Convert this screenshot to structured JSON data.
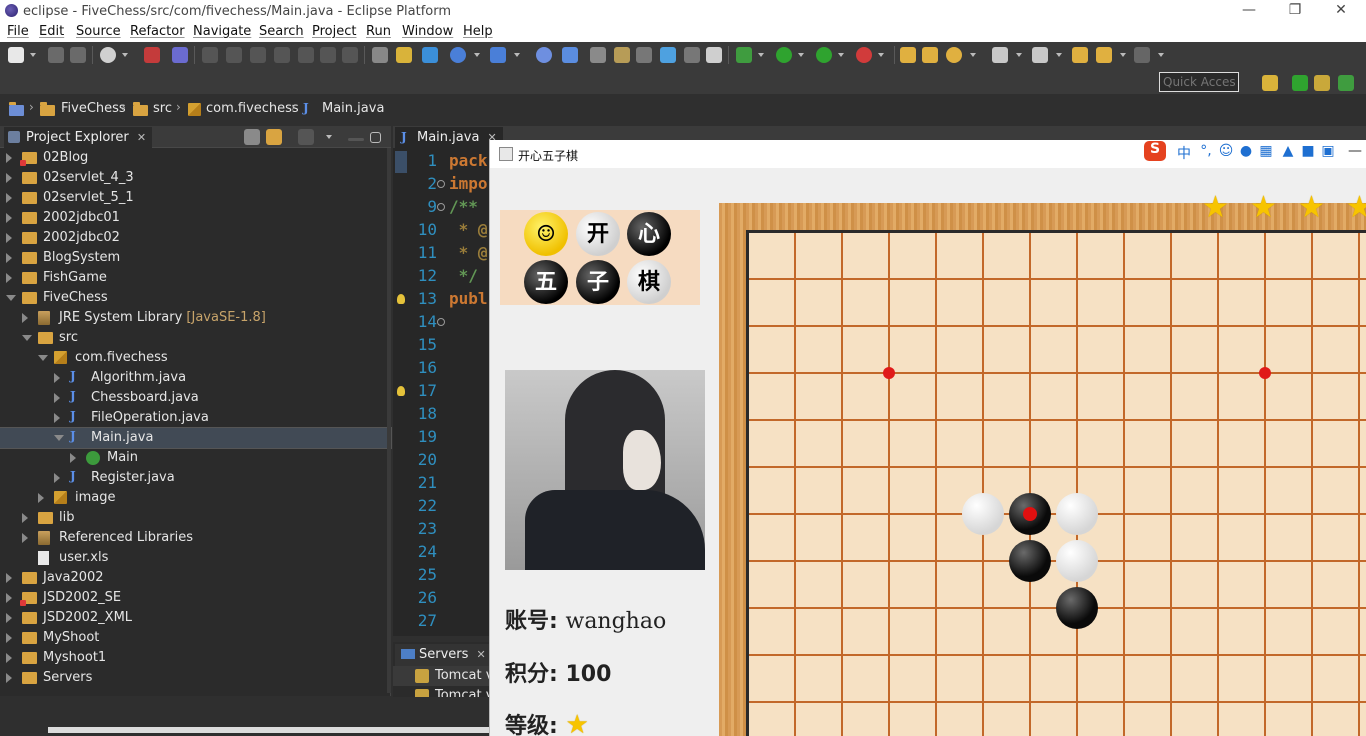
{
  "window": {
    "title": "eclipse - FiveChess/src/com/fivechess/Main.java - Eclipse Platform",
    "minimize": "—",
    "restore": "❐",
    "close": "✕"
  },
  "menu": [
    "File",
    "Edit",
    "Source",
    "Refactor",
    "Navigate",
    "Search",
    "Project",
    "Run",
    "Window",
    "Help"
  ],
  "toolbar": {
    "quick_access_placeholder": "Quick Access"
  },
  "breadcrumb": [
    "FiveChess",
    "src",
    "com.fivechess",
    "Main.java"
  ],
  "explorer": {
    "tab_label": "Project Explorer",
    "tab_close": "✕",
    "items": [
      {
        "label": "02Blog",
        "depth": 0,
        "kind": "project-error",
        "open": false
      },
      {
        "label": "02servlet_4_3",
        "depth": 0,
        "kind": "project",
        "open": false
      },
      {
        "label": "02servlet_5_1",
        "depth": 0,
        "kind": "project",
        "open": false
      },
      {
        "label": "2002jdbc01",
        "depth": 0,
        "kind": "project",
        "open": false
      },
      {
        "label": "2002jdbc02",
        "depth": 0,
        "kind": "project",
        "open": false
      },
      {
        "label": "BlogSystem",
        "depth": 0,
        "kind": "project",
        "open": false
      },
      {
        "label": "FishGame",
        "depth": 0,
        "kind": "project",
        "open": false
      },
      {
        "label": "FiveChess",
        "depth": 0,
        "kind": "project",
        "open": true
      },
      {
        "label": "JRE System Library",
        "suffix": "[JavaSE-1.8]",
        "depth": 1,
        "kind": "library",
        "open": false
      },
      {
        "label": "src",
        "depth": 1,
        "kind": "folder",
        "open": true
      },
      {
        "label": "com.fivechess",
        "depth": 2,
        "kind": "package",
        "open": true
      },
      {
        "label": "Algorithm.java",
        "depth": 3,
        "kind": "java",
        "open": false
      },
      {
        "label": "Chessboard.java",
        "depth": 3,
        "kind": "java",
        "open": false
      },
      {
        "label": "FileOperation.java",
        "depth": 3,
        "kind": "java",
        "open": false
      },
      {
        "label": "Main.java",
        "depth": 3,
        "kind": "java",
        "open": true,
        "selected": true
      },
      {
        "label": "Main",
        "depth": 4,
        "kind": "class",
        "open": false
      },
      {
        "label": "Register.java",
        "depth": 3,
        "kind": "java",
        "open": false
      },
      {
        "label": "image",
        "depth": 2,
        "kind": "package",
        "open": false
      },
      {
        "label": "lib",
        "depth": 1,
        "kind": "folder",
        "open": false
      },
      {
        "label": "Referenced Libraries",
        "depth": 1,
        "kind": "library",
        "open": false
      },
      {
        "label": "user.xls",
        "depth": 1,
        "kind": "file",
        "open": false,
        "noarrow": true
      },
      {
        "label": "Java2002",
        "depth": 0,
        "kind": "project",
        "open": false
      },
      {
        "label": "JSD2002_SE",
        "depth": 0,
        "kind": "project-error",
        "open": false
      },
      {
        "label": "JSD2002_XML",
        "depth": 0,
        "kind": "project",
        "open": false
      },
      {
        "label": "MyShoot",
        "depth": 0,
        "kind": "project",
        "open": false
      },
      {
        "label": "Myshoot1",
        "depth": 0,
        "kind": "project",
        "open": false
      },
      {
        "label": "Servers",
        "depth": 0,
        "kind": "project",
        "open": false
      }
    ]
  },
  "editor": {
    "tab_label": "Main.java",
    "tab_close": "✕",
    "lines": [
      {
        "n": "1",
        "code": "pack",
        "color": "#cc7832"
      },
      {
        "n": "2",
        "code": "impo",
        "color": "#cc7832",
        "fold": true
      },
      {
        "n": "9",
        "code": "/**",
        "color": "#629755",
        "fold": true
      },
      {
        "n": "10",
        "code": " * @",
        "color": "#9a7d3a"
      },
      {
        "n": "11",
        "code": " * @",
        "color": "#9a7d3a"
      },
      {
        "n": "12",
        "code": " */",
        "color": "#629755"
      },
      {
        "n": "13",
        "code": "publ",
        "color": "#cc7832",
        "bulb": true
      },
      {
        "n": "14",
        "code": "",
        "color": "#ddd",
        "fold": true
      },
      {
        "n": "15",
        "code": "",
        "color": "#ddd"
      },
      {
        "n": "16",
        "code": "",
        "color": "#ddd"
      },
      {
        "n": "17",
        "code": "",
        "color": "#ddd",
        "bulb": true
      },
      {
        "n": "18",
        "code": "",
        "color": "#ddd"
      },
      {
        "n": "19",
        "code": "",
        "color": "#ddd"
      },
      {
        "n": "20",
        "code": "",
        "color": "#ddd"
      },
      {
        "n": "21",
        "code": "",
        "color": "#ddd"
      },
      {
        "n": "22",
        "code": "",
        "color": "#ddd"
      },
      {
        "n": "23",
        "code": "",
        "color": "#ddd"
      },
      {
        "n": "24",
        "code": "",
        "color": "#ddd"
      },
      {
        "n": "25",
        "code": "",
        "color": "#ddd"
      },
      {
        "n": "26",
        "code": "",
        "color": "#ddd"
      },
      {
        "n": "27",
        "code": "",
        "color": "#ddd"
      }
    ]
  },
  "servers": {
    "tab_label": "Servers",
    "tab_close": "✕",
    "rows": [
      "Tomcat v",
      "Tomcat v"
    ]
  },
  "game": {
    "title": "开心五子棋",
    "logo_chars": [
      "开",
      "心",
      "五",
      "子",
      "棋"
    ],
    "account_label": "账号:",
    "account_value": "wanghao",
    "score_label": "积分:",
    "score_value": "100",
    "level_label": "等级:",
    "level_stars": 1,
    "top_stars": 4,
    "ime_label": "中",
    "board": {
      "stones": [
        {
          "col": 5,
          "row": 6,
          "color": "white"
        },
        {
          "col": 6,
          "row": 6,
          "color": "black",
          "last": true
        },
        {
          "col": 7,
          "row": 6,
          "color": "white"
        },
        {
          "col": 6,
          "row": 7,
          "color": "black"
        },
        {
          "col": 7,
          "row": 7,
          "color": "white"
        },
        {
          "col": 7,
          "row": 8,
          "color": "black"
        }
      ],
      "star_points": [
        {
          "col": 3,
          "row": 3
        },
        {
          "col": 11,
          "row": 3
        }
      ]
    }
  }
}
